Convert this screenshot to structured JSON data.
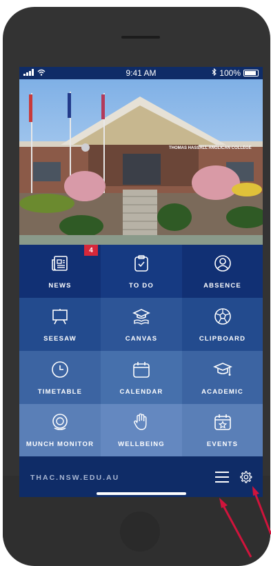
{
  "status_bar": {
    "time": "9:41 AM",
    "battery": "100%"
  },
  "hero": {
    "sign_text": "THOMAS HASSALL ANGLICAN COLLEGE"
  },
  "tiles": [
    {
      "label": "NEWS",
      "icon": "news-icon",
      "badge": "4"
    },
    {
      "label": "TO DO",
      "icon": "clipboard-check-icon"
    },
    {
      "label": "ABSENCE",
      "icon": "person-icon"
    },
    {
      "label": "SEESAW",
      "icon": "easel-icon"
    },
    {
      "label": "CANVAS",
      "icon": "graduation-cap-book-icon"
    },
    {
      "label": "CLIPBOARD",
      "icon": "soccer-ball-icon"
    },
    {
      "label": "TIMETABLE",
      "icon": "clock-icon"
    },
    {
      "label": "CALENDAR",
      "icon": "calendar-icon"
    },
    {
      "label": "ACADEMIC",
      "icon": "graduation-cap-icon"
    },
    {
      "label": "MUNCH MONITOR",
      "icon": "plate-icon"
    },
    {
      "label": "WELLBEING",
      "icon": "hand-icon"
    },
    {
      "label": "EVENTS",
      "icon": "calendar-star-icon"
    }
  ],
  "footer": {
    "url": "THAC.NSW.EDU.AU"
  },
  "colors": {
    "navy": "#0f2c67",
    "badge_red": "#d6283a",
    "arrow_red": "#d0143c"
  }
}
